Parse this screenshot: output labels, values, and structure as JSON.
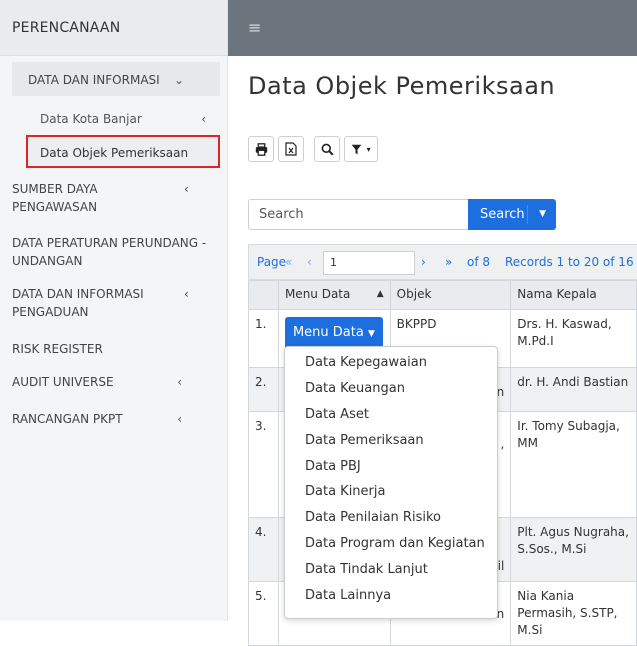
{
  "sidebar": {
    "brand": "PERENCANAAN",
    "items": [
      {
        "label": "DATA DAN INFORMASI",
        "chevron": "⌄"
      },
      {
        "label": "Data Kota Banjar",
        "chevron": "‹"
      },
      {
        "label": "Data Objek Pemeriksaan"
      },
      {
        "label": "SUMBER DAYA PENGAWASAN",
        "chevron": "‹"
      },
      {
        "label": "DATA PERATURAN PERUNDANG - UNDANGAN"
      },
      {
        "label": "DATA DAN INFORMASI PENGADUAN",
        "chevron": "‹"
      },
      {
        "label": "RISK REGISTER"
      },
      {
        "label": "AUDIT UNIVERSE",
        "chevron": "‹"
      },
      {
        "label": "RANCANGAN PKPT",
        "chevron": "‹"
      }
    ],
    "active_color": "#dc2626"
  },
  "topbar": {
    "menu_icon": "≡",
    "color": "#6c757d"
  },
  "main": {
    "title": "Data Objek Pemeriksaan",
    "search": {
      "placeholder": "Search",
      "button_label": "Search"
    },
    "pager": {
      "page_label": "Page",
      "page_value": "1",
      "of_label": "of 8",
      "records_label": "Records 1 to 20 of 16"
    },
    "table": {
      "headers": [
        "",
        "Menu Data",
        "Objek",
        "Nama Kepala"
      ],
      "rows": [
        {
          "no": "1.",
          "objek": "BKPPD",
          "kepala": "Drs. H. Kaswad, M.Pd.I"
        },
        {
          "no": "2.",
          "objek": "n",
          "kepala": "dr. H. Andi Bastian"
        },
        {
          "no": "3.",
          "objek": ",",
          "kepala": "Ir. Tomy Subagja, MM"
        },
        {
          "no": "4.",
          "objek": "il",
          "kepala": "Plt. Agus Nugraha, S.Sos., M.Si"
        },
        {
          "no": "5.",
          "objek": "an",
          "kepala": "Nia Kania Permasih, S.STP, M.Si"
        }
      ],
      "menu_button_label": "Menu Data"
    },
    "dropdown": [
      "Data Kepegawaian",
      "Data Keuangan",
      "Data Aset",
      "Data Pemeriksaan",
      "Data PBJ",
      "Data Kinerja",
      "Data Penilaian Risiko",
      "Data Program dan Kegiatan",
      "Data Tindak Lanjut",
      "Data Lainnya"
    ],
    "accent_color": "#1d6fe0"
  }
}
